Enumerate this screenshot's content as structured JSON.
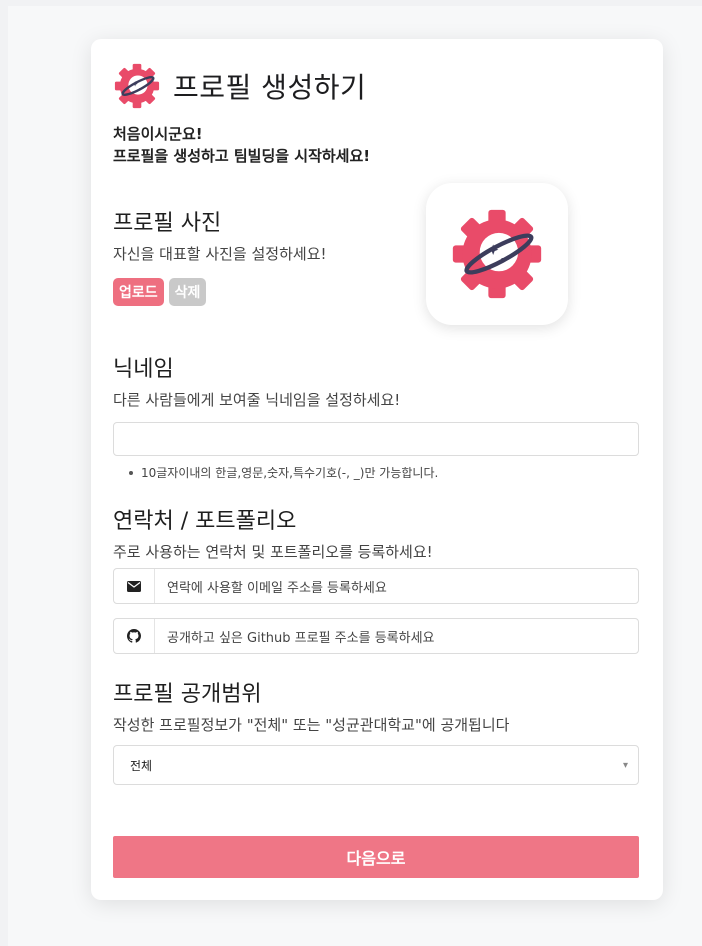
{
  "header": {
    "title": "프로필 생성하기",
    "logo_icon": "gear-planet-logo-icon"
  },
  "intro": {
    "line1": "처음이시군요!",
    "line2": "프로필을 생성하고 팀빌딩을 시작하세요!"
  },
  "photo": {
    "title": "프로필 사진",
    "description": "자신을 대표할 사진을 설정하세요!",
    "upload_label": "업로드",
    "delete_label": "삭제"
  },
  "nickname": {
    "title": "닉네임",
    "description": "다른 사람들에게 보여줄 닉네임을 설정하세요!",
    "value": "",
    "hint": "10글자이내의 한글,영문,숫자,특수기호(-, _)만 가능합니다."
  },
  "contact": {
    "title": "연락처 / 포트폴리오",
    "description": "주로 사용하는 연락처 및 포트폴리오를 등록하세요!",
    "email_placeholder": "연락에 사용할 이메일 주소를 등록하세요",
    "github_placeholder": "공개하고 싶은 Github 프로필 주소를 등록하세요"
  },
  "visibility": {
    "title": "프로필 공개범위",
    "description": "작성한 프로필정보가 \"전체\" 또는 \"성균관대학교\"에 공개됩니다",
    "selected": "전체"
  },
  "footer": {
    "next_label": "다음으로"
  },
  "colors": {
    "accent": "#ef7686",
    "logo": "#e94b69",
    "planet": "#3c3d5c",
    "disabled": "#c9c9c9"
  }
}
